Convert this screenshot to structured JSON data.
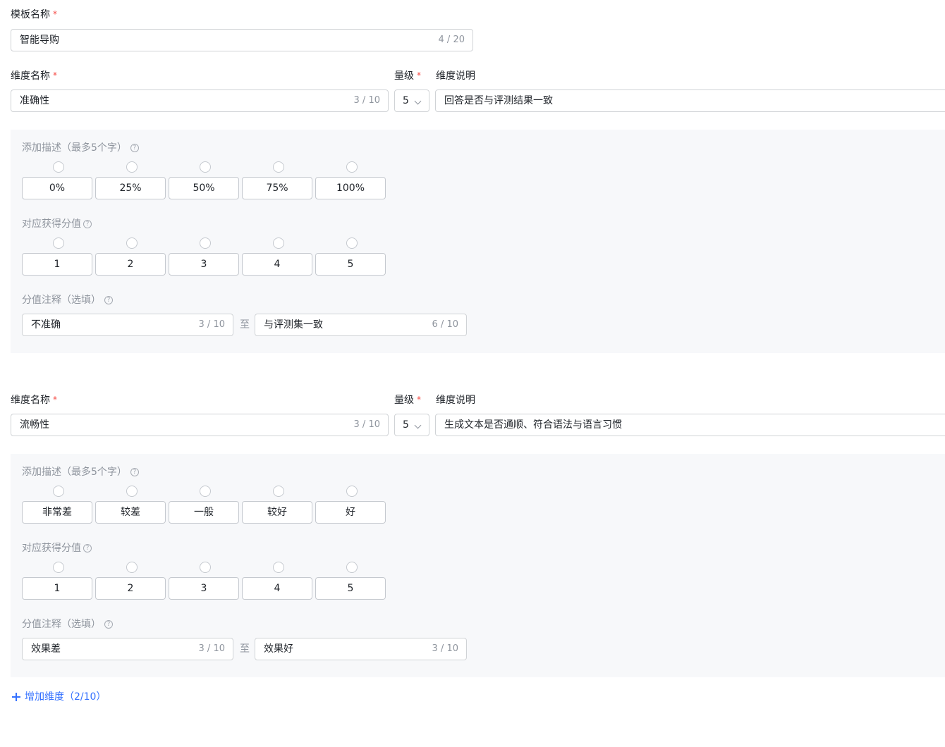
{
  "template": {
    "label": "模板名称",
    "required_mark": "*",
    "value": "智能导购",
    "count": "4 / 20"
  },
  "dimensions": [
    {
      "name_label": "维度名称",
      "name_value": "准确性",
      "name_count": "3 / 10",
      "level_label": "量级",
      "level_value": "5",
      "desc_label": "维度说明",
      "desc_value": "回答是否与评测结果一致",
      "desc_section_label": "添加描述（最多5个字）",
      "descriptions": [
        "0%",
        "25%",
        "50%",
        "75%",
        "100%"
      ],
      "score_section_label": "对应获得分值",
      "scores": [
        "1",
        "2",
        "3",
        "4",
        "5"
      ],
      "note_section_label": "分值注释（选填）",
      "note_low": "不准确",
      "note_low_count": "3 / 10",
      "note_to": "至",
      "note_high": "与评测集一致",
      "note_high_count": "6 / 10"
    },
    {
      "name_label": "维度名称",
      "name_value": "流畅性",
      "name_count": "3 / 10",
      "level_label": "量级",
      "level_value": "5",
      "desc_label": "维度说明",
      "desc_value": "生成文本是否通顺、符合语法与语言习惯",
      "desc_section_label": "添加描述（最多5个字）",
      "descriptions": [
        "非常差",
        "较差",
        "一般",
        "较好",
        "好"
      ],
      "score_section_label": "对应获得分值",
      "scores": [
        "1",
        "2",
        "3",
        "4",
        "5"
      ],
      "note_section_label": "分值注释（选填）",
      "note_low": "效果差",
      "note_low_count": "3 / 10",
      "note_to": "至",
      "note_high": "效果好",
      "note_high_count": "3 / 10"
    }
  ],
  "add_dimension_label": "增加维度（2/10）",
  "help_icon_glyph": "?",
  "colors": {
    "primary": "#3370ff",
    "required": "#f54a45",
    "panel_bg": "#f7f8fa",
    "muted_text": "#8f959e"
  }
}
